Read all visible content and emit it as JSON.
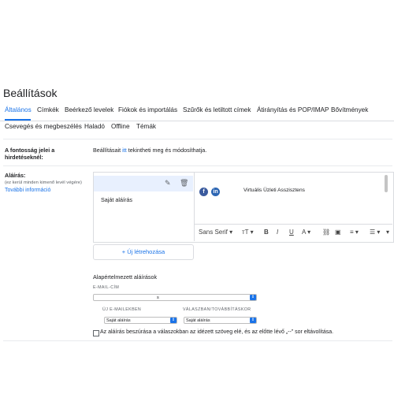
{
  "page_title": "Beállítások",
  "tabs": [
    "Általános",
    "Címkék",
    "Beérkező levelek",
    "Fiókok és importálás",
    "Szűrők és letiltott címek",
    "Átirányítás és POP/IMAP",
    "Bővítmények"
  ],
  "subtabs": [
    "Csevegés és megbeszélés",
    "Haladó",
    "Offline",
    "Témák"
  ],
  "importance": {
    "label": "A fontosság jelei a hirdetéseknél:",
    "text_before": "Beállításait",
    "link": "itt",
    "text_after": "tekintheti meg és módosíthatja."
  },
  "signature": {
    "label": "Aláírás:",
    "hint": "(ez kerül minden kimenő levél végére)",
    "more_info": "További információ",
    "items": [
      "Saját aláírás"
    ],
    "editor_text": "Virtuális Üzleti Asszisztens",
    "toolbar": {
      "font": "Sans Serif",
      "size_icon": "font-size-icon",
      "bold": "B",
      "italic": "I",
      "underline": "U",
      "text_color": "A"
    },
    "new_button": "Új létrehozása"
  },
  "defaults": {
    "heading": "Alapértelmezett aláírások",
    "email_label": "E-MAIL-CÍM",
    "email_value": "s",
    "new_label": "ÚJ E-MAILEKBEN",
    "new_value": "Saját aláírás",
    "reply_label": "VÁLASZBAN/TOVÁBBÍTÁSKOR",
    "reply_value": "Saját aláírás"
  },
  "checkbox_label": "Az aláírás beszúrása a válaszokban az idézett szöveg elé, és az előtte lévő „--” sor eltávolítása.",
  "colors": {
    "accent": "#1a73e8",
    "border": "#dadce0",
    "selected_bg": "#e8f0fe"
  }
}
